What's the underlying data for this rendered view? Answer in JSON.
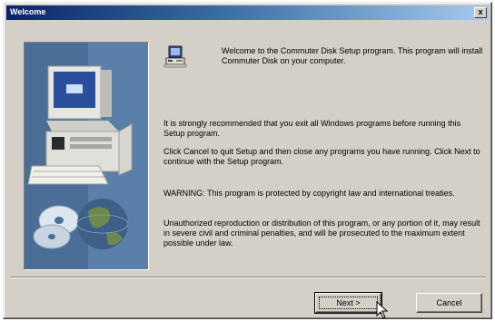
{
  "window": {
    "title": "Welcome",
    "close_glyph": "x"
  },
  "content": {
    "welcome": "Welcome to the Commuter Disk Setup program.  This program will install Commuter Disk on your computer.",
    "para1": "It is strongly recommended that you exit all Windows programs before running this Setup program.",
    "para2": "Click Cancel to quit Setup and then close any programs you have running. Click Next to continue with the Setup program.",
    "para3": "WARNING: This program is protected by copyright law and international treaties.",
    "para4": "Unauthorized reproduction or distribution of this program, or any portion of it, may result in severe civil and criminal penalties, and will be prosecuted to the maximum extent possible under law."
  },
  "buttons": {
    "next": "Next >",
    "cancel": "Cancel"
  },
  "icons": {
    "setup": "setup-computer-icon",
    "art": "computer-cd-globe-illustration",
    "cursor": "mouse-pointer-icon",
    "close": "close-icon"
  },
  "colors": {
    "title_bar_start": "#0a246a",
    "title_bar_end": "#a6caf0",
    "dialog_face": "#d4d0c8",
    "art_background": "#4a6e96"
  }
}
